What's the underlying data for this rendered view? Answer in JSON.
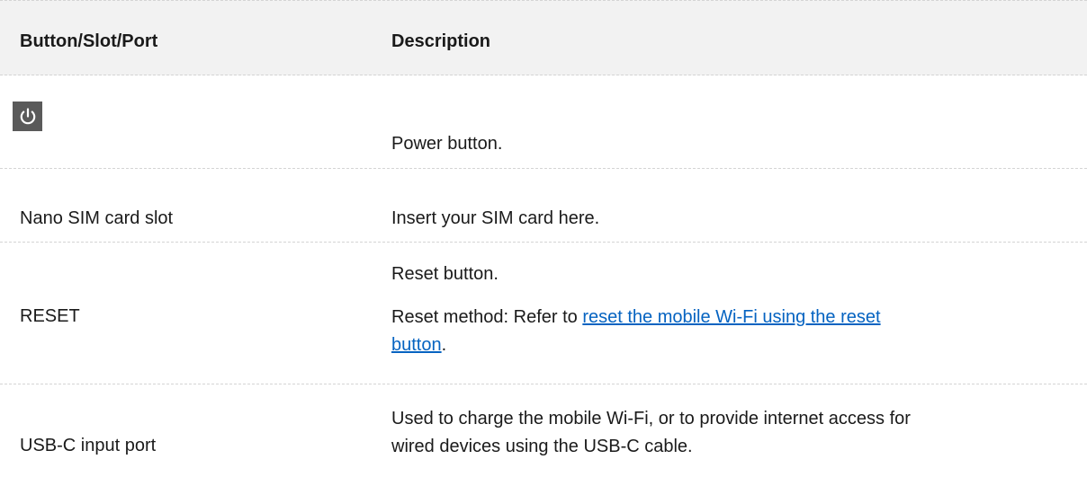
{
  "table": {
    "headers": [
      "Button/Slot/Port",
      "Description"
    ],
    "rows": [
      {
        "item_icon": "power-icon",
        "description": "Power button."
      },
      {
        "item": "Nano SIM card slot",
        "description": "Insert your SIM card here."
      },
      {
        "item": "RESET",
        "description_1": "Reset button.",
        "description_2_prefix": "Reset method: Refer to ",
        "description_2_link_a": "reset the mobile Wi-Fi using the reset ",
        "description_2_link_b": "button",
        "description_2_suffix": "."
      },
      {
        "item": "USB-C input port",
        "description_line1": "Used to charge the mobile Wi-Fi, or to provide internet access for",
        "description_line2": "wired devices using the USB-C cable."
      }
    ]
  },
  "colors": {
    "link": "#0563c1",
    "header_bg": "#f2f2f2",
    "icon_bg": "#5a5a5a"
  }
}
